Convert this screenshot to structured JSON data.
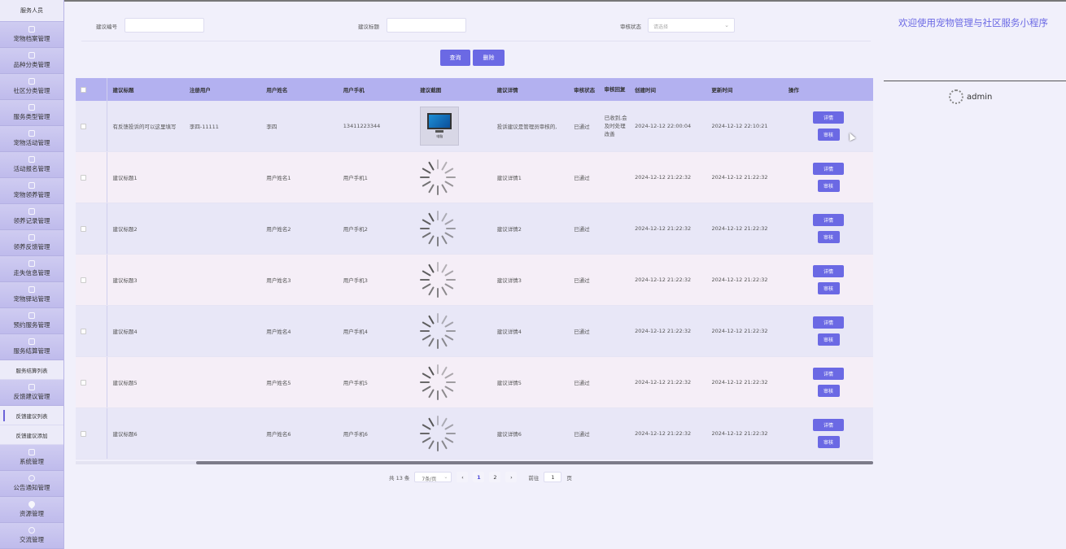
{
  "sidebar": {
    "header": "服务人员",
    "items": [
      {
        "label": "宠物档案管理",
        "icon": "folder-icon"
      },
      {
        "label": "品种分类管理",
        "icon": "folder-icon"
      },
      {
        "label": "社区分类管理",
        "icon": "folder-icon"
      },
      {
        "label": "服务类型管理",
        "icon": "folder-icon"
      },
      {
        "label": "宠物活动管理",
        "icon": "folder-icon"
      },
      {
        "label": "活动报名管理",
        "icon": "folder-icon"
      },
      {
        "label": "宠物领养管理",
        "icon": "folder-icon"
      },
      {
        "label": "领养记录管理",
        "icon": "folder-icon"
      },
      {
        "label": "领养反馈管理",
        "icon": "folder-icon"
      },
      {
        "label": "走失信息管理",
        "icon": "folder-icon"
      },
      {
        "label": "宠物驿站管理",
        "icon": "folder-icon"
      },
      {
        "label": "预约服务管理",
        "icon": "folder-icon"
      },
      {
        "label": "服务结算管理",
        "icon": "folder-icon"
      },
      {
        "label": "服务结算列表",
        "sub": true
      },
      {
        "label": "反馈建议管理",
        "icon": "folder-icon"
      },
      {
        "label": "反馈建议列表",
        "sub": true,
        "active": true
      },
      {
        "label": "反馈建议添加",
        "sub": true
      },
      {
        "label": "系统管理",
        "icon": "image-icon"
      },
      {
        "label": "公告通知管理",
        "icon": "info-icon"
      },
      {
        "label": "资源管理",
        "icon": "pin-icon"
      },
      {
        "label": "交流管理",
        "icon": "chat-icon"
      }
    ]
  },
  "filters": {
    "id_label": "建议编号",
    "title_label": "建议标题",
    "status_label": "审核状态",
    "status_placeholder": "请选择",
    "search_button": "查询",
    "delete_button": "删除"
  },
  "table": {
    "headers": [
      "建议标题",
      "注册用户",
      "用户姓名",
      "用户手机",
      "建议截图",
      "建议详情",
      "审核状态",
      "审核回复",
      "创建时间",
      "更新时间",
      "操作"
    ],
    "rows": [
      {
        "title": "有反馈投诉的可以这里填写",
        "user": "李四-11111",
        "name": "李四",
        "phone": "13411223344",
        "image": "monitor",
        "image_caption": "电脑",
        "detail": "投诉建议是管理员审核的,",
        "status": "已通过",
        "reply": "已收到,会及时处理改善",
        "created": "2024-12-12 22:00:04",
        "updated": "2024-12-12 22:10:21"
      },
      {
        "title": "建议标题1",
        "user": "",
        "name": "用户姓名1",
        "phone": "用户手机1",
        "image": "loading",
        "detail": "建议详情1",
        "status": "已通过",
        "reply": "",
        "created": "2024-12-12 21:22:32",
        "updated": "2024-12-12 21:22:32"
      },
      {
        "title": "建议标题2",
        "user": "",
        "name": "用户姓名2",
        "phone": "用户手机2",
        "image": "loading",
        "detail": "建议详情2",
        "status": "已通过",
        "reply": "",
        "created": "2024-12-12 21:22:32",
        "updated": "2024-12-12 21:22:32"
      },
      {
        "title": "建议标题3",
        "user": "",
        "name": "用户姓名3",
        "phone": "用户手机3",
        "image": "loading",
        "detail": "建议详情3",
        "status": "已通过",
        "reply": "",
        "created": "2024-12-12 21:22:32",
        "updated": "2024-12-12 21:22:32"
      },
      {
        "title": "建议标题4",
        "user": "",
        "name": "用户姓名4",
        "phone": "用户手机4",
        "image": "loading",
        "detail": "建议详情4",
        "status": "已通过",
        "reply": "",
        "created": "2024-12-12 21:22:32",
        "updated": "2024-12-12 21:22:32"
      },
      {
        "title": "建议标题5",
        "user": "",
        "name": "用户姓名5",
        "phone": "用户手机5",
        "image": "loading",
        "detail": "建议详情5",
        "status": "已通过",
        "reply": "",
        "created": "2024-12-12 21:22:32",
        "updated": "2024-12-12 21:22:32"
      },
      {
        "title": "建议标题6",
        "user": "",
        "name": "用户姓名6",
        "phone": "用户手机6",
        "image": "loading",
        "detail": "建议详情6",
        "status": "已通过",
        "reply": "",
        "created": "2024-12-12 21:22:32",
        "updated": "2024-12-12 21:22:32"
      }
    ],
    "detail_button": "详情",
    "audit_button": "审核"
  },
  "pagination": {
    "total": "共 13 条",
    "page_size": "7条/页",
    "prev": "‹",
    "pages": [
      "1",
      "2"
    ],
    "current": "1",
    "next": "›",
    "goto_label": "前往",
    "goto_value": "1",
    "goto_suffix": "页"
  },
  "header": {
    "welcome": "欢迎使用宠物管理与社区服务小程序",
    "username": "admin"
  },
  "colors": {
    "accent": "#6b69e4",
    "sidebar": "#c9c6ee",
    "table_header": "#b3b1f0"
  }
}
